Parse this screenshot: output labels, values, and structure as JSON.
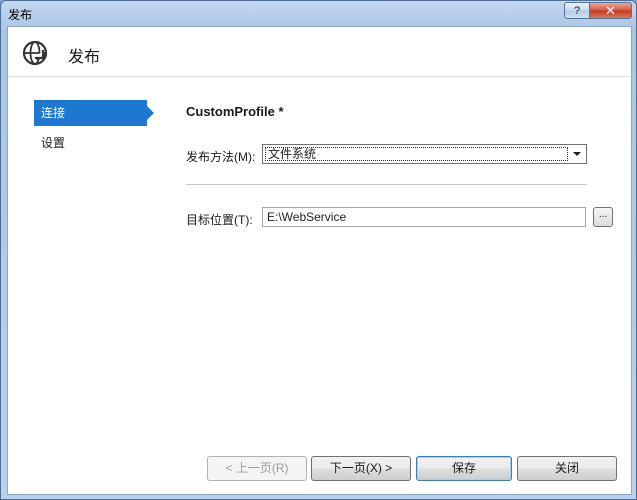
{
  "window": {
    "title": "发布",
    "help_label": "?",
    "close_label": "✕"
  },
  "header": {
    "title": "发布",
    "icon": "globe-publish-icon"
  },
  "sidebar": {
    "items": [
      {
        "label": "连接",
        "active": true
      },
      {
        "label": "设置",
        "active": false
      }
    ]
  },
  "main": {
    "profile_title": "CustomProfile *",
    "publish_method_label": "发布方法(M):",
    "publish_method_value": "文件系统",
    "target_location_label": "目标位置(T):",
    "target_location_value": "E:\\WebService",
    "browse_label": "..."
  },
  "footer": {
    "prev_label": "< 上一页(R)",
    "next_label": "下一页(X) >",
    "save_label": "保存",
    "close_label": "关闭"
  },
  "colors": {
    "accent": "#1e78d2",
    "title_bar": "#b9d1ec",
    "close_red": "#c33a22"
  }
}
